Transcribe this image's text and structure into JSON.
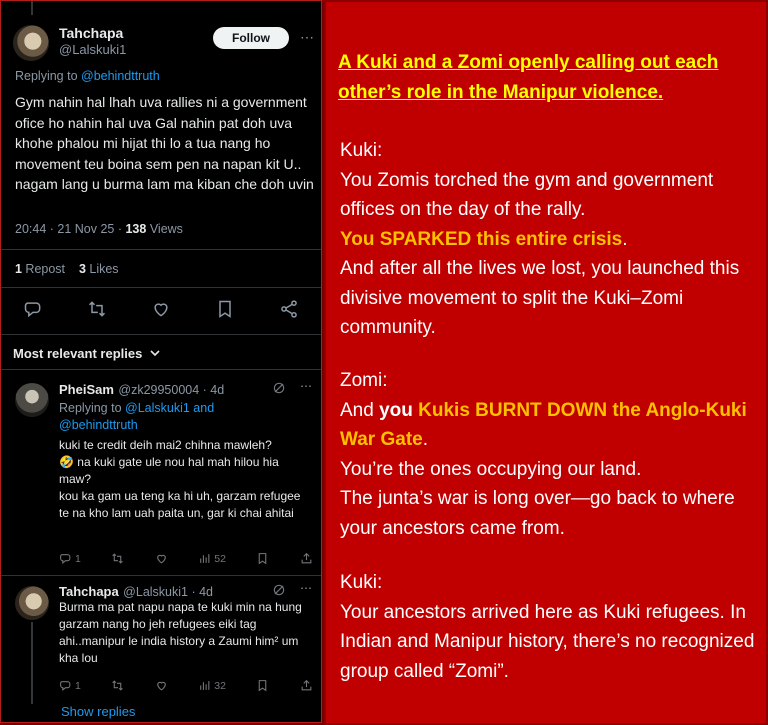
{
  "tweet": {
    "name": "Tahchapa",
    "handle": "@Lalskuki1",
    "follow_label": "Follow",
    "replying_prefix": "Replying to ",
    "replying_to": "@behindttruth",
    "text": "Gym nahin hal lhah uva rallies ni a government ofice ho nahin hal uva Gal nahin pat doh uva khohe phalou mi hijat thi lo a tua nang ho movement  teu boina sem pen na napan kit U.. nagam lang u burma lam ma kiban che doh uvin",
    "time": "20:44 · 21 Nov 25 · ",
    "views_count": "138",
    "views_label": " Views",
    "reposts_count": "1",
    "reposts_label": " Repost",
    "likes_count": "3",
    "likes_label": " Likes"
  },
  "replies_header": "Most relevant replies",
  "replies": [
    {
      "name": "PheiSam",
      "handle": "@zk29950004",
      "age": " · 4d",
      "replying_prefix": "Replying to ",
      "replying_to": "@Lalskuki1 and @behindttruth",
      "text": "kuki te credit deih mai2 chihna mawleh?\n🤣 na kuki gate ule nou hal mah hilou hia maw?\nkou ka gam ua teng ka hi uh, garzam refugee te na kho lam uah paita un, gar ki chai ahitai",
      "replies_count": "1",
      "views_count": "52"
    },
    {
      "name": "Tahchapa",
      "handle": "@Lalskuki1",
      "age": " · 4d",
      "text": "Burma ma pat napu napa te kuki min na hung garzam nang ho jeh  refugees eiki tag ahi..manipur le india history a Zaumi him² um kha lou",
      "replies_count": "1",
      "views_count": "32"
    }
  ],
  "show_replies": "Show replies",
  "commentary": {
    "title": "A Kuki and a Zomi openly calling out each other’s role in the Manipur violence.",
    "kuki1_label": "Kuki:",
    "kuki1_line1": "You Zomis torched the gym and government offices on the day of the rally.",
    "kuki1_highlight": "You SPARKED this entire crisis",
    "kuki1_after_highlight": ".",
    "kuki1_line3": "And after all the lives we lost, you launched this divisive movement to split the Kuki–Zomi community.",
    "zomi_label": "Zomi:",
    "zomi_prefix": "And ",
    "zomi_you": "you",
    "zomi_highlight": " Kukis BURNT DOWN the Anglo-Kuki War Gate",
    "zomi_after_highlight": ".",
    "zomi_line2": "You’re the ones occupying our land.",
    "zomi_line3": "The junta’s war is long over—go back to where your ancestors came from.",
    "kuki2_label": "Kuki:",
    "kuki2_text": "Your ancestors arrived here as Kuki refugees. In Indian and Manipur history, there’s no recognized group called “Zomi”."
  },
  "colors": {
    "panel_red": "#c00000",
    "title_yellow": "#ffff00",
    "highlight_orange": "#ffc000",
    "link_blue": "#1d9bf0"
  },
  "icons": [
    "reply-icon",
    "repost-icon",
    "like-icon",
    "bookmark-icon",
    "share-icon",
    "views-icon",
    "grok-icon",
    "chevron-down-icon"
  ]
}
